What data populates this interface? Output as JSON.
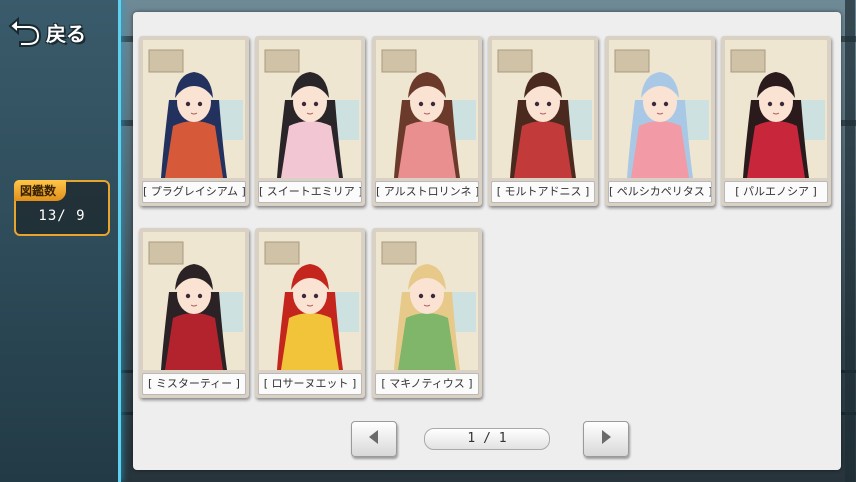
{
  "header": {
    "back_label": "戻る"
  },
  "counter": {
    "label": "図鑑数",
    "value": "13/ 9"
  },
  "cards": [
    {
      "name": "[ プラグレイシアム ]",
      "hair": "#23315f",
      "dress": "#d65a3a"
    },
    {
      "name": "[ スイートエミリア ]",
      "hair": "#2a2528",
      "dress": "#f2c6d2"
    },
    {
      "name": "[ アルストロリンネ ]",
      "hair": "#6b3a2a",
      "dress": "#e98f8f"
    },
    {
      "name": "[ モルトアドニス ]",
      "hair": "#4a2a1e",
      "dress": "#c23a3a"
    },
    {
      "name": "[ ペルシカペリタス ]",
      "hair": "#a9c8e6",
      "dress": "#f29aa5"
    },
    {
      "name": "[ パルエノシア ]",
      "hair": "#2b1a1c",
      "dress": "#c8263a"
    },
    {
      "name": "[ ミスターティー ]",
      "hair": "#2a2224",
      "dress": "#b3232e"
    },
    {
      "name": "[ ロサーヌエット ]",
      "hair": "#c4261e",
      "dress": "#f2c43a"
    },
    {
      "name": "[ マキノティウス ]",
      "hair": "#e7c98a",
      "dress": "#7fb66a"
    }
  ],
  "pagination": {
    "indicator": "1 / 1"
  },
  "colors": {
    "accent": "#5fd1f0",
    "counter_border": "#e8a52c",
    "panel": "#eeeeee"
  }
}
